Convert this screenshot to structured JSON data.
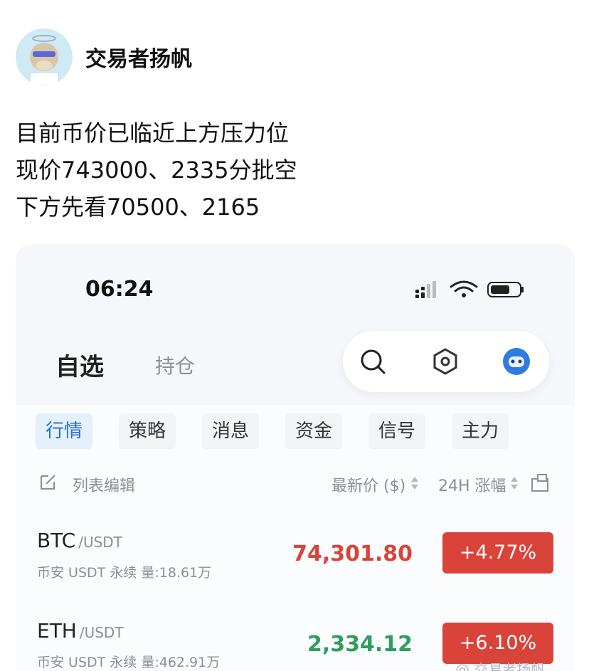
{
  "post": {
    "author": "交易者扬帆",
    "lines": [
      "目前币价已临近上方压力位",
      "现价743000、2335分批空",
      "下方先看70500、2165"
    ]
  },
  "app": {
    "status_time": "06:24",
    "tabs": {
      "active": "自选",
      "secondary": "持仓"
    },
    "chips": [
      "行情",
      "策略",
      "消息",
      "资金",
      "信号",
      "主力"
    ],
    "active_chip": "行情",
    "list_header": {
      "edit": "列表编辑",
      "price": "最新价 ($)",
      "change": "24H 涨幅"
    },
    "rows": [
      {
        "symbol": "BTC",
        "quote": "/USDT",
        "exchange": "币安 USDT 永续",
        "volume": "量:18.61万",
        "price": "74,301.80",
        "change": "+4.77%",
        "price_color": "#d9433a"
      },
      {
        "symbol": "ETH",
        "quote": "/USDT",
        "exchange": "币安 USDT 永续",
        "volume": "量:462.91万",
        "price": "2,334.12",
        "change": "+6.10%",
        "price_color": "#2f9e5f"
      }
    ]
  },
  "watermark": "交易者扬帆",
  "colors": {
    "up_red": "#d9433a",
    "down_green": "#2f9e5f",
    "accent_blue": "#1f6fd6"
  }
}
